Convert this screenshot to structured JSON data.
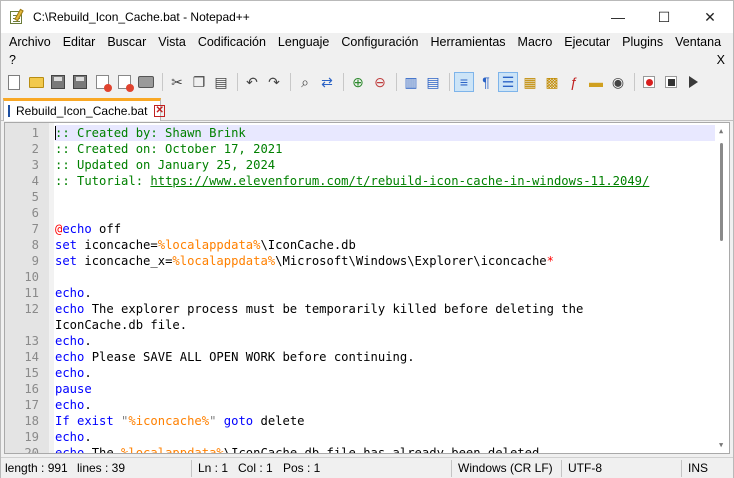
{
  "window": {
    "title": "C:\\Rebuild_Icon_Cache.bat - Notepad++",
    "minimize": "—",
    "maximize": "☐",
    "close": "✕"
  },
  "menu": {
    "items": [
      "Archivo",
      "Editar",
      "Buscar",
      "Vista",
      "Codificación",
      "Lenguaje",
      "Configuración",
      "Herramientas",
      "Macro",
      "Ejecutar",
      "Plugins",
      "Ventana"
    ],
    "help": "?",
    "close_doc": "X"
  },
  "toolbar": {
    "icons": [
      "new-file-icon",
      "open-file-icon",
      "save-icon",
      "save-all-icon",
      "close-icon",
      "close-all-icon",
      "print-icon",
      "cut-icon",
      "copy-icon",
      "paste-icon",
      "undo-icon",
      "redo-icon",
      "find-icon",
      "replace-icon",
      "zoom-in-icon",
      "zoom-out-icon",
      "sync-vertical-icon",
      "sync-horizontal-icon",
      "word-wrap-icon",
      "show-all-chars-icon",
      "indent-guide-icon",
      "lang-define-icon",
      "doc-map-icon",
      "function-list-icon",
      "folder-workspace-icon",
      "monitoring-icon",
      "record-macro-icon",
      "stop-record-icon",
      "playback-icon"
    ]
  },
  "tab": {
    "label": "Rebuild_Icon_Cache.bat",
    "close": "✕"
  },
  "editor": {
    "lines": [
      {
        "n": "1",
        "segs": [
          {
            "t": ":: Created by: Shawn Brink",
            "c": "comment"
          }
        ]
      },
      {
        "n": "2",
        "segs": [
          {
            "t": ":: Created on: October 17, 2021",
            "c": "comment"
          }
        ]
      },
      {
        "n": "3",
        "segs": [
          {
            "t": ":: Updated on January 25, 2024",
            "c": "comment"
          }
        ]
      },
      {
        "n": "4",
        "segs": [
          {
            "t": ":: Tutorial: ",
            "c": "comment"
          },
          {
            "t": "https://www.elevenforum.com/t/rebuild-icon-cache-in-windows-11.2049/",
            "c": "link"
          }
        ]
      },
      {
        "n": "5",
        "segs": []
      },
      {
        "n": "6",
        "segs": []
      },
      {
        "n": "7",
        "segs": [
          {
            "t": "@",
            "c": "at"
          },
          {
            "t": "echo",
            "c": "keyword"
          },
          {
            "t": " off",
            "c": "plain"
          }
        ]
      },
      {
        "n": "8",
        "segs": [
          {
            "t": "set",
            "c": "keyword"
          },
          {
            "t": " iconcache=",
            "c": "plain"
          },
          {
            "t": "%localappdata%",
            "c": "var"
          },
          {
            "t": "\\IconCache.db",
            "c": "plain"
          }
        ]
      },
      {
        "n": "9",
        "segs": [
          {
            "t": "set",
            "c": "keyword"
          },
          {
            "t": " iconcache_x=",
            "c": "plain"
          },
          {
            "t": "%localappdata%",
            "c": "var"
          },
          {
            "t": "\\Microsoft\\Windows\\Explorer\\iconcache",
            "c": "plain"
          },
          {
            "t": "*",
            "c": "star"
          }
        ]
      },
      {
        "n": "10",
        "segs": []
      },
      {
        "n": "11",
        "segs": [
          {
            "t": "echo",
            "c": "keyword"
          },
          {
            "t": ".",
            "c": "plain"
          }
        ]
      },
      {
        "n": "12",
        "segs": [
          {
            "t": "echo",
            "c": "keyword"
          },
          {
            "t": " The explorer process must be temporarily killed before deleting the",
            "c": "plain"
          }
        ]
      },
      {
        "n": "",
        "segs": [
          {
            "t": "IconCache.db file.",
            "c": "plain"
          }
        ]
      },
      {
        "n": "13",
        "segs": [
          {
            "t": "echo",
            "c": "keyword"
          },
          {
            "t": ".",
            "c": "plain"
          }
        ]
      },
      {
        "n": "14",
        "segs": [
          {
            "t": "echo",
            "c": "keyword"
          },
          {
            "t": " Please SAVE ALL OPEN WORK before continuing.",
            "c": "plain"
          }
        ]
      },
      {
        "n": "15",
        "segs": [
          {
            "t": "echo",
            "c": "keyword"
          },
          {
            "t": ".",
            "c": "plain"
          }
        ]
      },
      {
        "n": "16",
        "segs": [
          {
            "t": "pause",
            "c": "keyword"
          }
        ]
      },
      {
        "n": "17",
        "segs": [
          {
            "t": "echo",
            "c": "keyword"
          },
          {
            "t": ".",
            "c": "plain"
          }
        ]
      },
      {
        "n": "18",
        "segs": [
          {
            "t": "If exist",
            "c": "keyword"
          },
          {
            "t": " ",
            "c": "plain"
          },
          {
            "t": "\"",
            "c": "string"
          },
          {
            "t": "%iconcache%",
            "c": "var"
          },
          {
            "t": "\"",
            "c": "string"
          },
          {
            "t": " ",
            "c": "plain"
          },
          {
            "t": "goto",
            "c": "keyword"
          },
          {
            "t": " delete",
            "c": "plain"
          }
        ]
      },
      {
        "n": "19",
        "segs": [
          {
            "t": "echo",
            "c": "keyword"
          },
          {
            "t": ".",
            "c": "plain"
          }
        ]
      },
      {
        "n": "20",
        "segs": [
          {
            "t": "echo",
            "c": "keyword"
          },
          {
            "t": " The ",
            "c": "plain"
          },
          {
            "t": "%localappdata%",
            "c": "var"
          },
          {
            "t": "\\IconCache.db file has already been deleted.",
            "c": "plain"
          }
        ]
      }
    ]
  },
  "status": {
    "length": "length : 991",
    "lines": "lines : 39",
    "ln": "Ln : 1",
    "col": "Col : 1",
    "pos": "Pos : 1",
    "eol": "Windows (CR LF)",
    "encoding": "UTF-8",
    "mode": "INS"
  }
}
